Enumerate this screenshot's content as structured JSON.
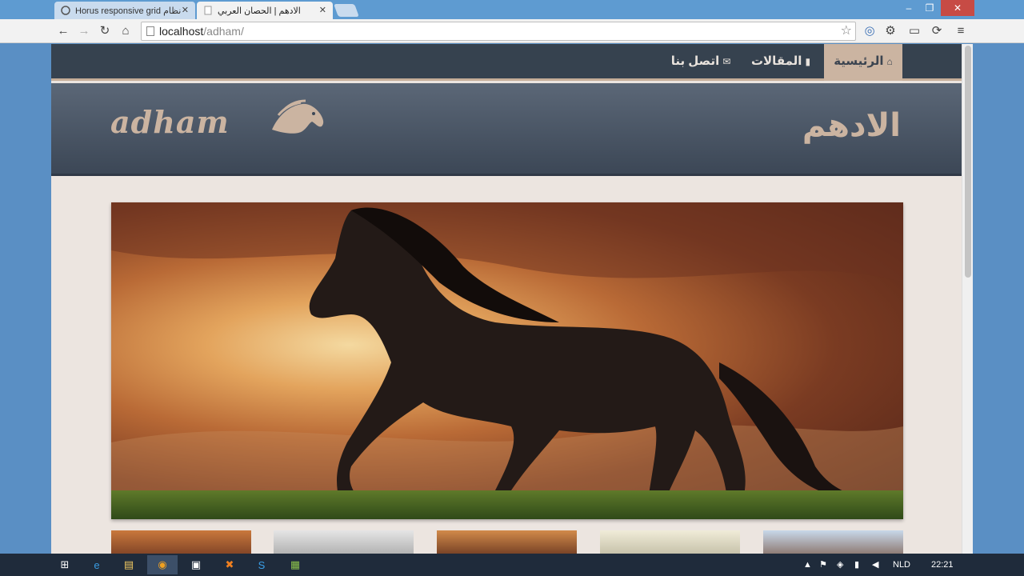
{
  "browser": {
    "tabs": [
      {
        "title": "Horus responsive grid نظام",
        "active": false
      },
      {
        "title": "الادهم | الحصان العربي",
        "active": true
      }
    ],
    "url_host": "localhost",
    "url_path": "/adham/",
    "window_controls": {
      "minimize": "–",
      "maximize": "❐",
      "close": "✕"
    }
  },
  "site": {
    "nav": [
      {
        "label": "الرئيسية",
        "icon": "home-icon",
        "active": true
      },
      {
        "label": "المقالات",
        "icon": "book-icon",
        "active": false
      },
      {
        "label": "اتصل بنا",
        "icon": "envelope-icon",
        "active": false
      }
    ],
    "logo_arabic": "الادهم",
    "logo_english": "adham"
  },
  "taskbar": {
    "language": "NLD",
    "time": "22:21"
  },
  "colors": {
    "nav_bg": "#36424f",
    "accent": "#cbb4a1",
    "page_bg": "#ece5e0"
  }
}
